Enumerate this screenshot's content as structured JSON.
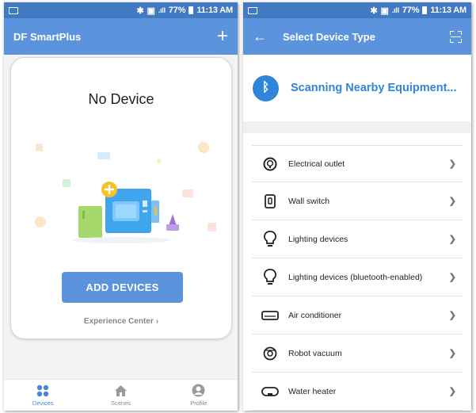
{
  "status_bar": {
    "icons": [
      "bluetooth-icon",
      "vibrate-icon",
      "signal-icon"
    ],
    "battery": "77%",
    "time": "11:13 AM"
  },
  "left_screen": {
    "app_title": "DF SmartPlus",
    "add_icon": "plus-icon",
    "empty_title": "No Device",
    "add_button": "ADD DEVICES",
    "experience_link": "Experience Center",
    "tabs": [
      {
        "label": "Devices",
        "icon": "devices-grid-icon",
        "active": true
      },
      {
        "label": "Scenes",
        "icon": "home-icon",
        "active": false
      },
      {
        "label": "Profile",
        "icon": "profile-icon",
        "active": false
      }
    ]
  },
  "right_screen": {
    "title": "Select Device Type",
    "back_icon": "back-arrow-icon",
    "scan_icon": "scan-icon",
    "scanning_text": "Scanning Nearby Equipment...",
    "devices": [
      {
        "label": "Electrical outlet",
        "icon": "outlet-icon"
      },
      {
        "label": "Wall switch",
        "icon": "wall-switch-icon"
      },
      {
        "label": "Lighting devices",
        "icon": "bulb-icon"
      },
      {
        "label": "Lighting devices (bluetooth-enabled)",
        "icon": "bulb-icon"
      },
      {
        "label": "Air conditioner",
        "icon": "air-conditioner-icon"
      },
      {
        "label": "Robot vacuum",
        "icon": "robot-vacuum-icon"
      },
      {
        "label": "Water heater",
        "icon": "water-heater-icon"
      }
    ]
  },
  "colors": {
    "status_bar": "#417ac2",
    "app_bar": "#5b93dc",
    "accent": "#2f86d8",
    "active_tab": "#4a86d8"
  }
}
